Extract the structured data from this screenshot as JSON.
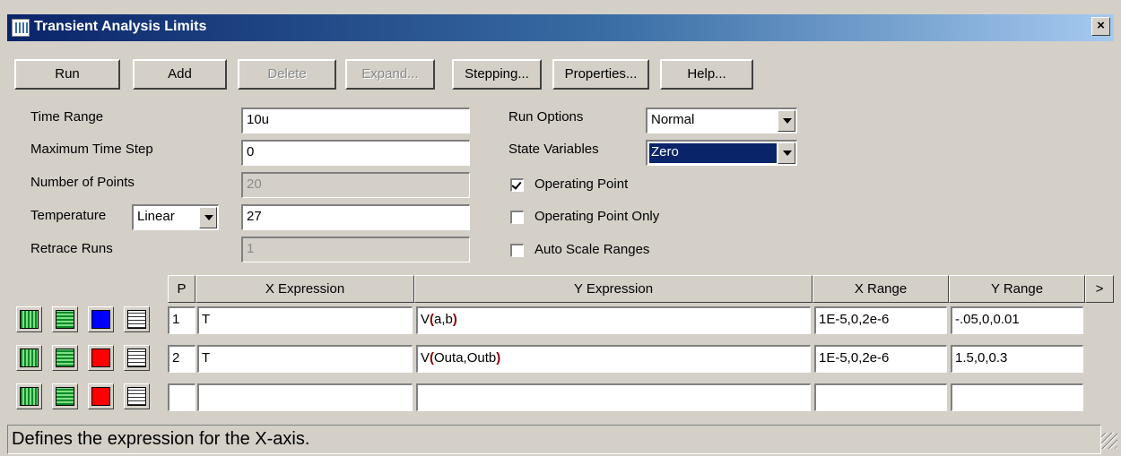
{
  "window": {
    "title": "Transient Analysis Limits",
    "close_label": "×"
  },
  "toolbar": [
    {
      "label": "Run",
      "enabled": true
    },
    {
      "label": "Add",
      "enabled": true
    },
    {
      "label": "Delete",
      "enabled": false
    },
    {
      "label": "Expand...",
      "enabled": false
    },
    {
      "label": "Stepping...",
      "enabled": true
    },
    {
      "label": "Properties...",
      "enabled": true
    },
    {
      "label": "Help...",
      "enabled": true
    }
  ],
  "fields": {
    "time_range": {
      "label": "Time Range",
      "value": "10u"
    },
    "max_time_step": {
      "label": "Maximum Time Step",
      "value": "0"
    },
    "num_points": {
      "label": "Number of Points",
      "value": "20"
    },
    "temperature": {
      "label": "Temperature",
      "mode": "Linear",
      "value": "27"
    },
    "retrace_runs": {
      "label": "Retrace Runs",
      "value": "1"
    }
  },
  "options": {
    "run_options": {
      "label": "Run Options",
      "value": "Normal"
    },
    "state_variables": {
      "label": "State Variables",
      "value": "Zero"
    },
    "operating_point": {
      "label": "Operating Point",
      "checked": true
    },
    "operating_point_only": {
      "label": "Operating Point Only",
      "checked": false
    },
    "auto_scale_ranges": {
      "label": "Auto Scale Ranges",
      "checked": false
    }
  },
  "grid": {
    "headers": {
      "p": "P",
      "x_expr": "X Expression",
      "y_expr": "Y Expression",
      "x_range": "X Range",
      "y_range": "Y Range",
      "more": ">"
    },
    "rows": [
      {
        "p": "1",
        "x_expr": "T",
        "y_func": "V",
        "y_args": "a,b",
        "x_range": "1E-5,0,2e-6",
        "y_range": "-.05,0,0.01",
        "color": "#0000ff"
      },
      {
        "p": "2",
        "x_expr": "T",
        "y_func": "V",
        "y_args": "Outa,Outb",
        "x_range": "1E-5,0,2e-6",
        "y_range": "1.5,0,0.3",
        "color": "#ff0000"
      },
      {
        "p": "",
        "x_expr": "",
        "y_func": "",
        "y_args": "",
        "x_range": "",
        "y_range": "",
        "color": "#ff0000"
      }
    ]
  },
  "status": {
    "text": "Defines the expression for the X-axis."
  }
}
